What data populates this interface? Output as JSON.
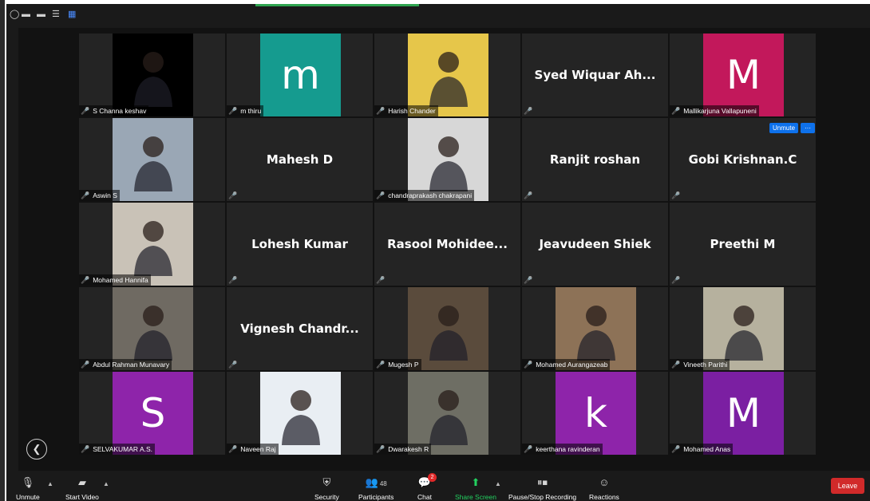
{
  "toolbar": {
    "unmute": "Unmute",
    "start_video": "Start Video",
    "security": "Security",
    "participants": "Participants",
    "participants_count": "48",
    "chat": "Chat",
    "chat_badge": "2",
    "share_screen": "Share Screen",
    "recording": "Pause/Stop Recording",
    "reactions": "Reactions",
    "leave": "Leave"
  },
  "hover_controls": {
    "unmute": "Unmute",
    "more": "···"
  },
  "tiles": [
    {
      "name": "S Channa keshav",
      "avatar": "photo",
      "color": "#000000"
    },
    {
      "name": "m thiru",
      "avatar": "letter",
      "letter": "m",
      "color": "#159b8f"
    },
    {
      "name": "Harish Chander",
      "avatar": "photo",
      "color": "#e6c64a"
    },
    {
      "name": "",
      "display": "Syed Wiquar Ah...",
      "avatar": "none"
    },
    {
      "name": "Mallikarjuna Vallapuneni",
      "avatar": "letter",
      "letter": "M",
      "color": "#c2185b"
    },
    {
      "name": "Aswin S",
      "avatar": "photo",
      "color": "#9aa7b5"
    },
    {
      "name": "",
      "display": "Mahesh D",
      "avatar": "none"
    },
    {
      "name": "chandraprakash chakrapani",
      "avatar": "photo",
      "color": "#d7d7d7"
    },
    {
      "name": "",
      "display": "Ranjit roshan",
      "avatar": "none"
    },
    {
      "name": "",
      "display": "Gobi Krishnan.C",
      "avatar": "none"
    },
    {
      "name": "Mohamed Hannifa",
      "avatar": "photo",
      "color": "#c9c2b7"
    },
    {
      "name": "",
      "display": "Lohesh Kumar",
      "avatar": "none"
    },
    {
      "name": "",
      "display": "Rasool  Mohidee...",
      "avatar": "none"
    },
    {
      "name": "",
      "display": "Jeavudeen Shiek",
      "avatar": "none"
    },
    {
      "name": "",
      "display": "Preethi M",
      "avatar": "none"
    },
    {
      "name": "Abdul Rahman Munavary",
      "avatar": "photo",
      "color": "#6f6a62"
    },
    {
      "name": "",
      "display": "Vignesh  Chandr...",
      "avatar": "none"
    },
    {
      "name": "Mugesh P",
      "avatar": "photo",
      "color": "#5a4b3c"
    },
    {
      "name": "Mohamed Aurangazeab",
      "avatar": "photo",
      "color": "#8d7257"
    },
    {
      "name": "Vineeth Parithi",
      "avatar": "photo",
      "color": "#b6b19e"
    },
    {
      "name": "SELVAKUMAR A.S.",
      "avatar": "letter",
      "letter": "S",
      "color": "#8e24aa"
    },
    {
      "name": "Naveen Raj",
      "avatar": "photo",
      "color": "#e9eef3"
    },
    {
      "name": "Dwarakesh R",
      "avatar": "photo",
      "color": "#6e6e64"
    },
    {
      "name": "keerthana ravinderan",
      "avatar": "letter",
      "letter": "k",
      "color": "#8e24aa"
    },
    {
      "name": "Mohamed Anas",
      "avatar": "letter",
      "letter": "M",
      "color": "#7b1fa2"
    }
  ]
}
